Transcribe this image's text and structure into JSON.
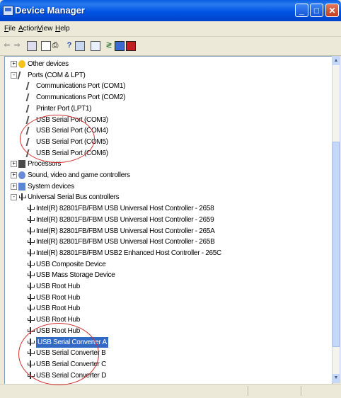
{
  "window": {
    "title": "Device Manager"
  },
  "menu": [
    {
      "key": "F",
      "rest": "ile"
    },
    {
      "key": "A",
      "rest": "ction"
    },
    {
      "key": "V",
      "rest": "iew"
    },
    {
      "key": "H",
      "rest": "elp"
    }
  ],
  "toolbar": [
    "back-arrow-icon",
    "forward-arrow-icon",
    "console-tree-icon",
    "properties-icon",
    "print-icon",
    "help-icon",
    "view-icon",
    "scan-hardware-icon",
    "update-driver-icon",
    "uninstall-icon"
  ],
  "tree": [
    {
      "indent": 0,
      "expander": "+",
      "icon": "warning",
      "label": "Other devices"
    },
    {
      "indent": 0,
      "expander": "-",
      "icon": "port",
      "label": "Ports (COM & LPT)"
    },
    {
      "indent": 1,
      "icon": "port",
      "label": "Communications Port (COM1)"
    },
    {
      "indent": 1,
      "icon": "port",
      "label": "Communications Port (COM2)"
    },
    {
      "indent": 1,
      "icon": "port",
      "label": "Printer Port (LPT1)"
    },
    {
      "indent": 1,
      "icon": "port",
      "label": "USB Serial Port (COM3)"
    },
    {
      "indent": 1,
      "icon": "port",
      "label": "USB Serial Port (COM4)"
    },
    {
      "indent": 1,
      "icon": "port",
      "label": "USB Serial Port (COM5)"
    },
    {
      "indent": 1,
      "icon": "port",
      "label": "USB Serial Port (COM6)"
    },
    {
      "indent": 0,
      "expander": "+",
      "icon": "chip",
      "label": "Processors"
    },
    {
      "indent": 0,
      "expander": "+",
      "icon": "sound",
      "label": "Sound, video and game controllers"
    },
    {
      "indent": 0,
      "expander": "+",
      "icon": "system",
      "label": "System devices"
    },
    {
      "indent": 0,
      "expander": "-",
      "icon": "usb",
      "label": "Universal Serial Bus controllers"
    },
    {
      "indent": 1,
      "icon": "usb",
      "label": "Intel(R) 82801FB/FBM USB Universal Host Controller - 2658"
    },
    {
      "indent": 1,
      "icon": "usb",
      "label": "Intel(R) 82801FB/FBM USB Universal Host Controller - 2659"
    },
    {
      "indent": 1,
      "icon": "usb",
      "label": "Intel(R) 82801FB/FBM USB Universal Host Controller - 265A"
    },
    {
      "indent": 1,
      "icon": "usb",
      "label": "Intel(R) 82801FB/FBM USB Universal Host Controller - 265B"
    },
    {
      "indent": 1,
      "icon": "usb",
      "label": "Intel(R) 82801FB/FBM USB2 Enhanced Host Controller - 265C"
    },
    {
      "indent": 1,
      "icon": "usb",
      "label": "USB Composite Device"
    },
    {
      "indent": 1,
      "icon": "usb",
      "label": "USB Mass Storage Device"
    },
    {
      "indent": 1,
      "icon": "usb",
      "label": "USB Root Hub"
    },
    {
      "indent": 1,
      "icon": "usb",
      "label": "USB Root Hub"
    },
    {
      "indent": 1,
      "icon": "usb",
      "label": "USB Root Hub"
    },
    {
      "indent": 1,
      "icon": "usb",
      "label": "USB Root Hub"
    },
    {
      "indent": 1,
      "icon": "usb",
      "label": "USB Root Hub"
    },
    {
      "indent": 1,
      "icon": "usb",
      "label": "USB Serial Converter A",
      "selected": true
    },
    {
      "indent": 1,
      "icon": "usb",
      "label": "USB Serial Converter B"
    },
    {
      "indent": 1,
      "icon": "usb",
      "label": "USB Serial Converter C"
    },
    {
      "indent": 1,
      "icon": "usb",
      "label": "USB Serial Converter D"
    }
  ],
  "colors": {
    "selection": "#316ac5",
    "annotation": "#d23131",
    "titlebar": "#0054e3"
  }
}
